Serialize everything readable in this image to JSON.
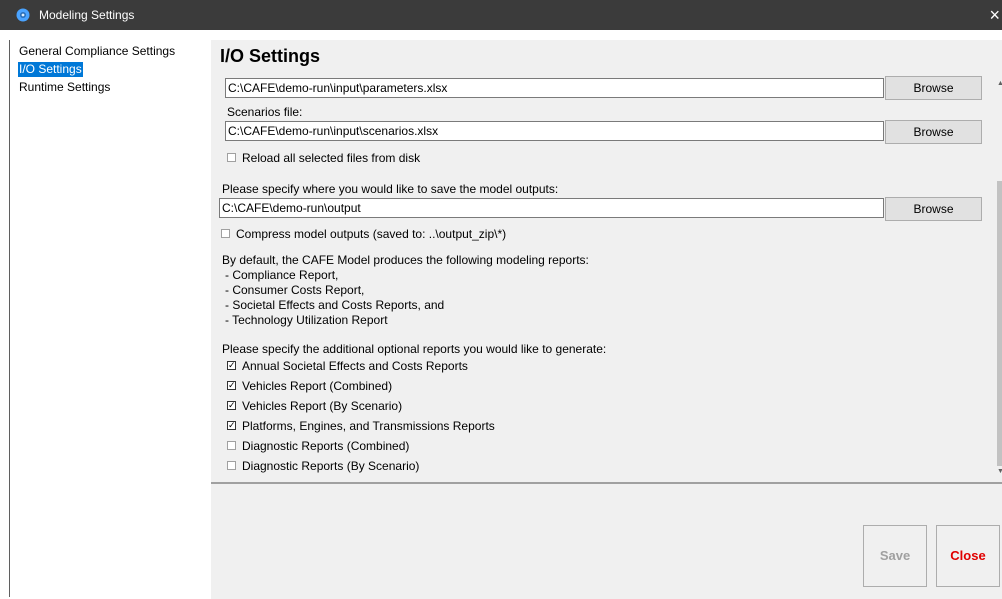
{
  "window": {
    "title": "Modeling Settings",
    "close_glyph": "×",
    "icon": "gear-icon"
  },
  "nav": {
    "items": [
      {
        "label": "General Compliance Settings",
        "selected": false
      },
      {
        "label": "I/O Settings",
        "selected": true
      },
      {
        "label": "Runtime Settings",
        "selected": false
      }
    ]
  },
  "io": {
    "heading": "I/O Settings",
    "parameters_file": "C:\\CAFE\\demo-run\\input\\parameters.xlsx",
    "scenarios_label": "Scenarios file:",
    "scenarios_file": "C:\\CAFE\\demo-run\\input\\scenarios.xlsx",
    "browse_label": "Browse",
    "reload_label": "Reload all selected files from disk",
    "reload_checked": false,
    "output_label": "Please specify where you would like to save the model outputs:",
    "output_path": "C:\\CAFE\\demo-run\\output",
    "compress_label": "Compress model outputs (saved to: ..\\output_zip\\*)",
    "compress_checked": false,
    "default_reports_intro": "By default, the CAFE Model produces the following modeling reports:",
    "default_reports": [
      " - Compliance Report,",
      " - Consumer Costs  Report,",
      " - Societal Effects and Costs Reports, and",
      " - Technology Utilization Report"
    ],
    "optional_intro": "Please specify the additional optional reports you would like to generate:",
    "optional_reports": [
      {
        "label": "Annual Societal Effects and Costs Reports",
        "checked": true
      },
      {
        "label": "Vehicles Report (Combined)",
        "checked": true
      },
      {
        "label": "Vehicles Report (By Scenario)",
        "checked": true
      },
      {
        "label": "Platforms, Engines, and Transmissions Reports",
        "checked": true
      },
      {
        "label": "Diagnostic Reports (Combined)",
        "checked": false
      },
      {
        "label": "Diagnostic Reports (By Scenario)",
        "checked": false
      }
    ]
  },
  "actions": {
    "save_label": "Save",
    "close_label": "Close",
    "save_enabled": false,
    "close_color": "#e00000"
  },
  "colors": {
    "titlebar": "#3b3b3b",
    "selection": "#0078d7",
    "panel": "#f0f0f0"
  }
}
